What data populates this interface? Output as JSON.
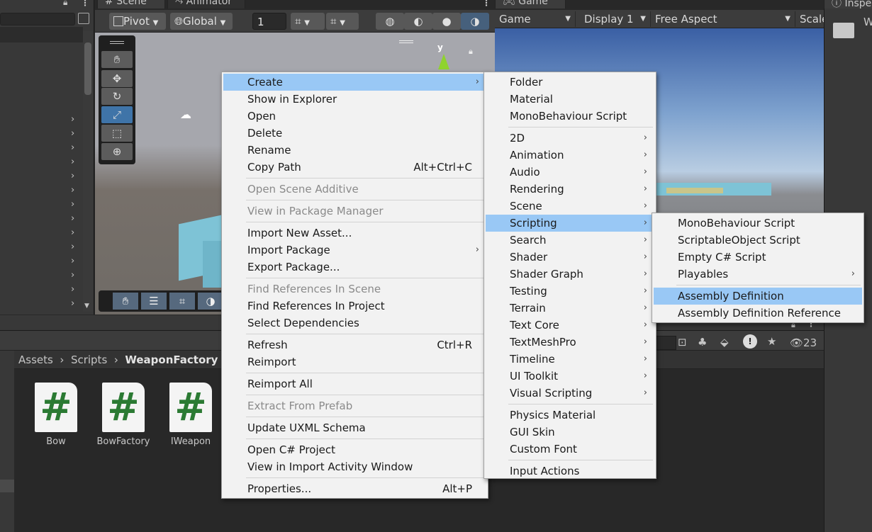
{
  "tabs": {
    "scene": "Scene",
    "animator": "Animator",
    "game": "Game",
    "inspector": "Inspe"
  },
  "scene_toolbar": {
    "pivot": "Pivot",
    "global": "Global",
    "grid_value": "1"
  },
  "game_toolbar": {
    "display_mode": "Game",
    "display": "Display 1",
    "aspect": "Free Aspect",
    "scale": "Scale"
  },
  "inspector": {
    "label": "W"
  },
  "project": {
    "breadcrumb": [
      "Assets",
      "Scripts",
      "WeaponFactory"
    ],
    "hidden_count": "23",
    "assets": [
      {
        "name": "Bow",
        "glyph": "#"
      },
      {
        "name": "BowFactory",
        "glyph": "#"
      },
      {
        "name": "IWeapon",
        "glyph": "#"
      }
    ]
  },
  "context_menu": {
    "items": [
      {
        "label": "Create",
        "shortcut": "",
        "submenu": true,
        "highlighted": true
      },
      {
        "label": "Show in Explorer"
      },
      {
        "label": "Open"
      },
      {
        "label": "Delete"
      },
      {
        "label": "Rename"
      },
      {
        "label": "Copy Path",
        "shortcut": "Alt+Ctrl+C"
      },
      {
        "label": "Open Scene Additive",
        "disabled": true
      },
      {
        "label": "View in Package Manager",
        "disabled": true
      },
      {
        "label": "Import New Asset..."
      },
      {
        "label": "Import Package",
        "submenu": true
      },
      {
        "label": "Export Package..."
      },
      {
        "label": "Find References In Scene",
        "disabled": true
      },
      {
        "label": "Find References In Project"
      },
      {
        "label": "Select Dependencies"
      },
      {
        "label": "Refresh",
        "shortcut": "Ctrl+R"
      },
      {
        "label": "Reimport"
      },
      {
        "label": "Reimport All"
      },
      {
        "label": "Extract From Prefab",
        "disabled": true
      },
      {
        "label": "Update UXML Schema"
      },
      {
        "label": "Open C# Project"
      },
      {
        "label": "View in Import Activity Window"
      },
      {
        "label": "Properties...",
        "shortcut": "Alt+P"
      }
    ]
  },
  "create_menu": {
    "items": [
      {
        "label": "Folder"
      },
      {
        "label": "Material"
      },
      {
        "label": "MonoBehaviour Script"
      },
      {
        "label": "2D",
        "submenu": true
      },
      {
        "label": "Animation",
        "submenu": true
      },
      {
        "label": "Audio",
        "submenu": true
      },
      {
        "label": "Rendering",
        "submenu": true
      },
      {
        "label": "Scene",
        "submenu": true
      },
      {
        "label": "Scripting",
        "submenu": true,
        "highlighted": true
      },
      {
        "label": "Search",
        "submenu": true
      },
      {
        "label": "Shader",
        "submenu": true
      },
      {
        "label": "Shader Graph",
        "submenu": true
      },
      {
        "label": "Testing",
        "submenu": true
      },
      {
        "label": "Terrain",
        "submenu": true
      },
      {
        "label": "Text Core",
        "submenu": true
      },
      {
        "label": "TextMeshPro",
        "submenu": true
      },
      {
        "label": "Timeline",
        "submenu": true
      },
      {
        "label": "UI Toolkit",
        "submenu": true
      },
      {
        "label": "Visual Scripting",
        "submenu": true
      },
      {
        "label": "Physics Material"
      },
      {
        "label": "GUI Skin"
      },
      {
        "label": "Custom Font"
      },
      {
        "label": "Input Actions"
      }
    ]
  },
  "scripting_menu": {
    "items": [
      {
        "label": "MonoBehaviour Script"
      },
      {
        "label": "ScriptableObject Script"
      },
      {
        "label": "Empty C# Script"
      },
      {
        "label": "Playables",
        "submenu": true
      },
      {
        "label": "Assembly Definition",
        "highlighted": true
      },
      {
        "label": "Assembly Definition Reference"
      }
    ]
  },
  "colors": {
    "highlight": "#99c8f5",
    "menu_bg": "#f2f2f2",
    "script_glyph": "#2b7a33",
    "active_tool": "#3f74a8"
  },
  "icons": [
    "hand-icon",
    "move-icon",
    "rotate-icon",
    "scale-icon",
    "rect-icon",
    "transform-icon",
    "gizmo-icon",
    "folder-icon",
    "lock-icon"
  ]
}
